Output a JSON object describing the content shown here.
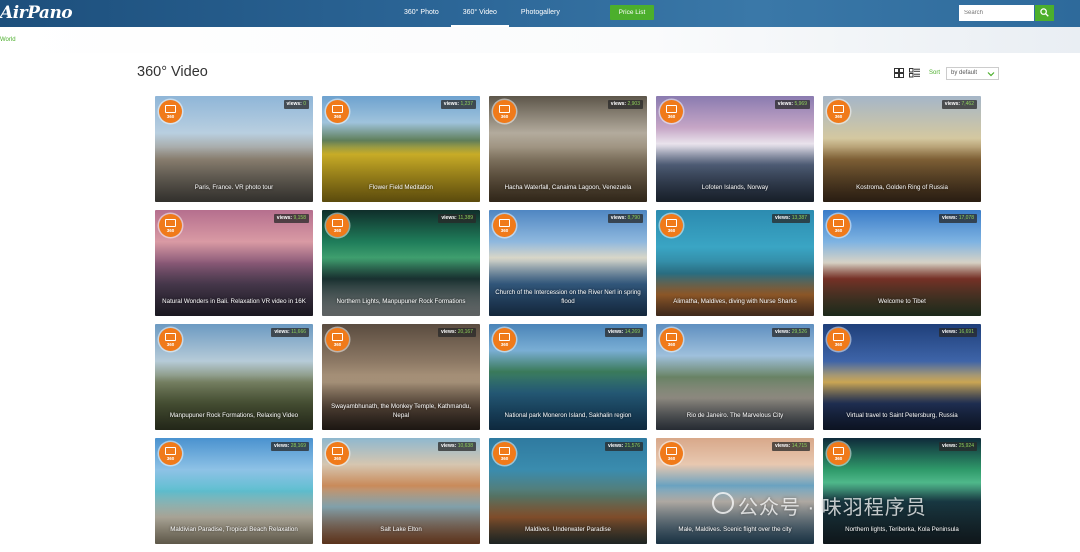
{
  "header": {
    "logo": "AirPano",
    "nav": [
      "360° Photo",
      "360° Video",
      "Photogallery"
    ],
    "active_nav": 1,
    "price_button": "Price List",
    "search_placeholder": "Search"
  },
  "breadcrumb": "World",
  "page_title": "360° Video",
  "sort": {
    "label": "Sort",
    "value": "by default"
  },
  "badge_text": "360",
  "views_label": "views:",
  "cards": [
    {
      "title": "Paris, France. VR photo tour",
      "views": "0",
      "bg": "linear-gradient(180deg,#8fb6d8 0%,#b9cfe0 35%,#9a8e7d 60%,#6e6a62 100%)"
    },
    {
      "title": "Flower Field Meditation",
      "views": "1,237",
      "bg": "linear-gradient(180deg,#6ea2cf 0%,#9fc3dc 25%,#5f7e5a 42%,#d7b92a 55%,#c9a51c 100%)"
    },
    {
      "title": "Hacha Waterfall, Canaima Lagoon, Venezuela",
      "views": "2,903",
      "bg": "linear-gradient(180deg,#5d564a 0%,#b3ab9d 35%,#8e806a 60%,#6a5438 100%)"
    },
    {
      "title": "Lofoten Islands, Norway",
      "views": "5,969",
      "bg": "linear-gradient(180deg,#8a7bb0 0%,#c6a6c6 30%,#e9e3ec 45%,#5d6e8c 65%,#34445a 100%)"
    },
    {
      "title": "Kostroma, Golden Ring of Russia",
      "views": "7,462",
      "bg": "linear-gradient(180deg,#a5b6c8 0%,#d4c8a0 40%,#8f6c3c 60%,#5b4128 100%)"
    },
    {
      "title": "Natural Wonders in Bali. Relaxation VR video in 16K",
      "views": "9,158",
      "bg": "linear-gradient(180deg,#b56f8e 0%,#d99aa4 30%,#8b5a78 50%,#5a4760 70%,#3a3548 100%)"
    },
    {
      "title": "Northern Lights, Manpupuner Rock Formations",
      "views": "11,389",
      "bg": "linear-gradient(180deg,#0f2e2a 0%,#1f7d5a 30%,#3f9e6e 45%,#1e3b3a 65%,#cfd6d8 100%)"
    },
    {
      "title": "Church of the Intercession on the River Nerl in spring flood",
      "views": "8,790",
      "bg": "linear-gradient(180deg,#4f86c2 0%,#8fb8de 30%,#d8d6c8 45%,#3f6f9e 70%,#2b5582 100%)"
    },
    {
      "title": "Alimatha, Maldives, diving with Nurse Sharks",
      "views": "13,387",
      "bg": "linear-gradient(180deg,#2c8bb0 0%,#3aa5c4 35%,#2f7c93 60%,#d2813a 80%,#8a5a3c 100%)"
    },
    {
      "title": "Welcome to Tibet",
      "views": "17,078",
      "bg": "linear-gradient(180deg,#3a7cc8 0%,#7eb3e2 30%,#d9d3c5 50%,#8e3b2e 65%,#3f5a3a 100%)"
    },
    {
      "title": "Manpupuner Rock Formations, Relaxing Video",
      "views": "11,666",
      "bg": "linear-gradient(180deg,#6c9ac2 0%,#b6cbd8 35%,#7d8868 55%,#5f6b45 75%,#4c5536 100%)"
    },
    {
      "title": "Swayambhunath, the Monkey Temple, Kathmandu, Nepal",
      "views": "20,167",
      "bg": "linear-gradient(180deg,#5a4c40 0%,#8c7864 35%,#b09a80 55%,#6a5646 80%,#3f3229 100%)"
    },
    {
      "title": "National park Moneron Island, Sakhalin region",
      "views": "14,269",
      "bg": "linear-gradient(180deg,#4a84b8 0%,#7aaed4 25%,#3a7a5a 45%,#2b6a8c 65%,#1f5a88 100%)"
    },
    {
      "title": "Rio de Janeiro. The Marvelous City",
      "views": "29,526",
      "bg": "linear-gradient(180deg,#5f8fc0 0%,#9fc0dc 30%,#6a8466 50%,#b6b0a4 70%,#556070 100%)"
    },
    {
      "title": "Virtual travel to Saint Petersburg, Russia",
      "views": "16,691",
      "bg": "linear-gradient(180deg,#1f3f7a 0%,#3e64a8 35%,#d9b25a 55%,#2a3f70 75%,#1a2a4a 100%)"
    },
    {
      "title": "Maldivian Paradise, Tropical Beach Relaxation",
      "views": "28,169",
      "bg": "linear-gradient(180deg,#4a92cf 0%,#8ec2e6 30%,#5fbfd0 50%,#e9e2cf 75%,#cfc2a2 100%)"
    },
    {
      "title": "Salt Lake Elton",
      "views": "10,638",
      "bg": "linear-gradient(180deg,#8fb8cf 0%,#d6c6b0 25%,#c98a5a 45%,#9cc2cf 65%,#c8703e 100%)"
    },
    {
      "title": "Maldives. Underwater Paradise",
      "views": "21,576",
      "bg": "linear-gradient(180deg,#2f7aa0 0%,#3a8cae 30%,#5b7a6a 55%,#b06a3a 75%,#3f4f4a 100%)"
    },
    {
      "title": "Male, Maldives. Scenic flight over the city",
      "views": "14,715",
      "bg": "linear-gradient(180deg,#d8a88a 0%,#e8c8b0 25%,#6aa2c0 45%,#c7c0b8 60%,#3c6f93 100%)"
    },
    {
      "title": "Northern lights, Teriberka, Kola Peninsula",
      "views": "25,924",
      "bg": "linear-gradient(180deg,#0e2a3a 0%,#2f9a6a 30%,#4fb88a 42%,#1b3f4a 60%,#20313a 100%)"
    }
  ],
  "watermark": "公众号 · 味羽程序员"
}
